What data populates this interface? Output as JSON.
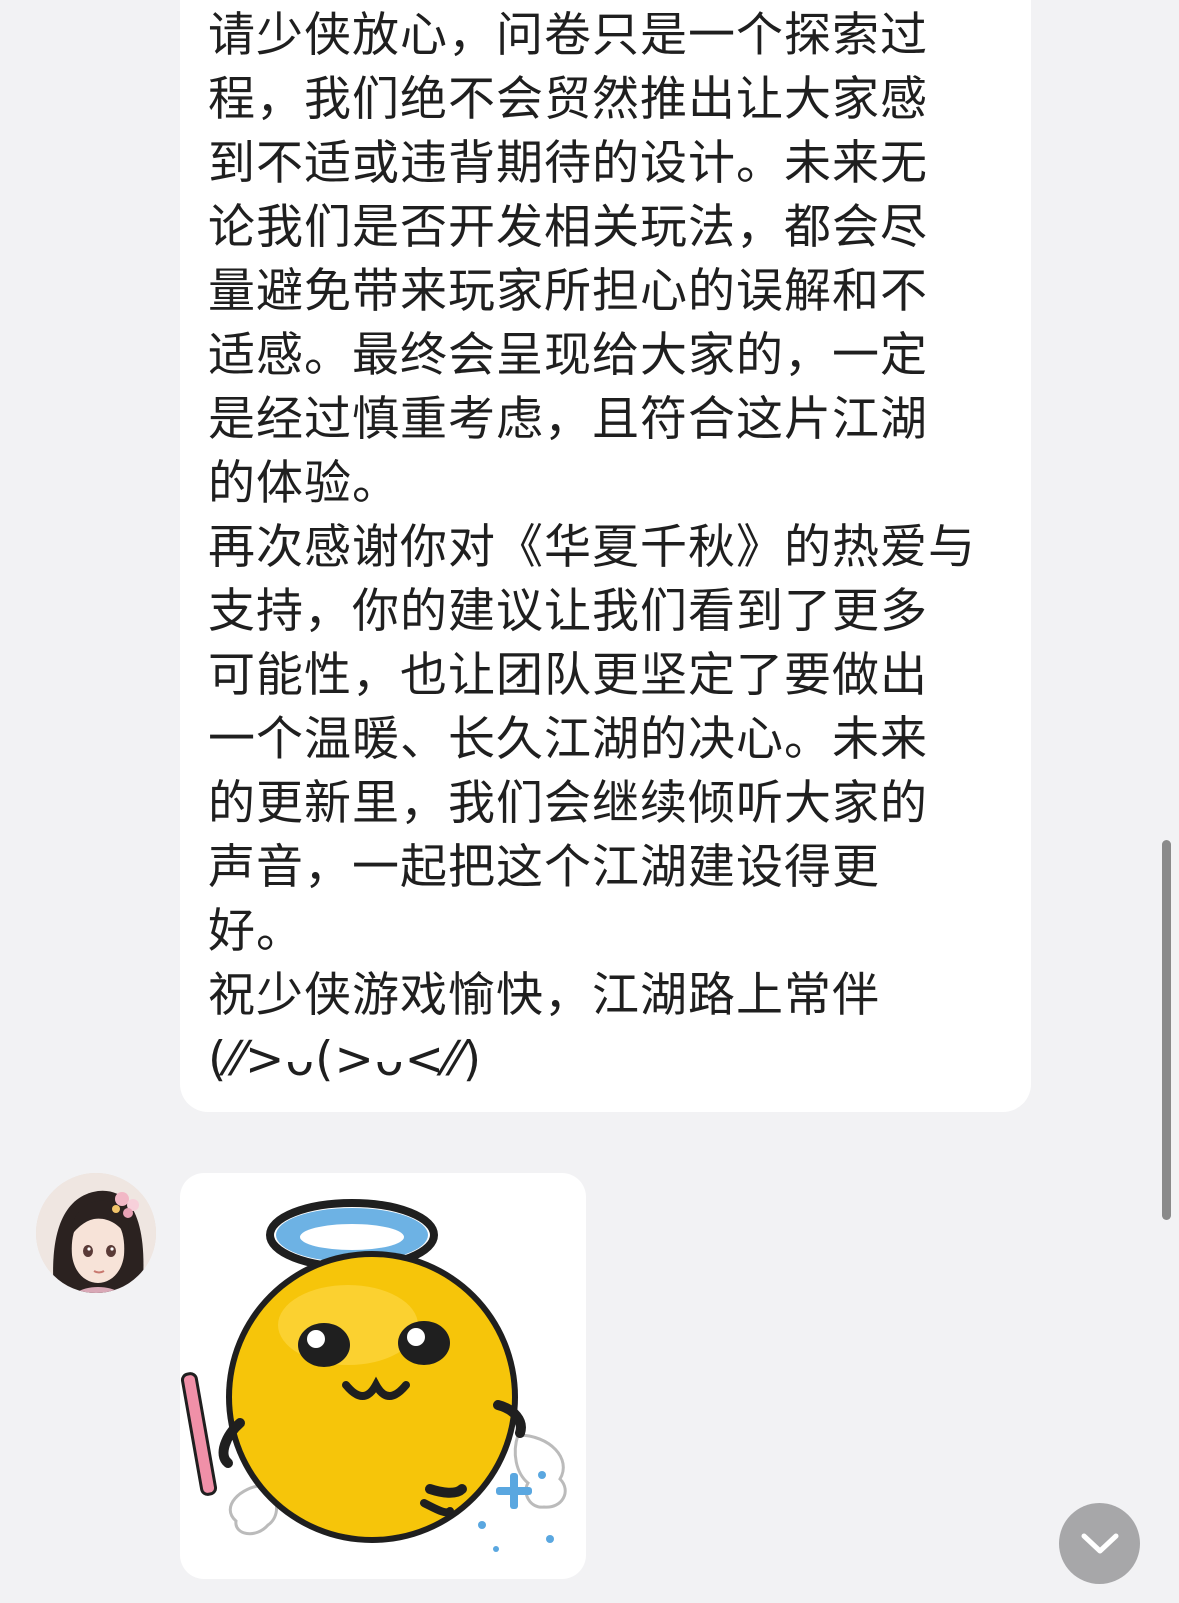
{
  "message": {
    "paragraphs": [
      {
        "lines": [
          "请少侠放心，问卷只是一个探索过",
          "程，我们绝不会贸然推出让大家感",
          "到不适或违背期待的设计。未来无",
          "论我们是否开发相关玩法，都会尽",
          "量避免带来玩家所担心的误解和不",
          "适感。最终会呈现给大家的，一定",
          "是经过慎重考虑，且符合这片江湖",
          "的体验。"
        ]
      },
      {
        "lines": [
          "再次感谢你对《华夏千秋》的热爱与",
          "支持，你的建议让我们看到了更多",
          "可能性，也让团队更坚定了要做出",
          "一个温暖、长久江湖的决心。未来",
          "的更新里，我们会继续倾听大家的",
          "声音，一起把这个江湖建设得更",
          "好。"
        ]
      },
      {
        "lines": [
          "祝少侠游戏愉快，江湖路上常伴",
          "(⁄⁄>ᴗ(>ᴗ<⁄⁄)"
        ]
      }
    ]
  },
  "avatar": {
    "icon": "avatar-anime-girl"
  },
  "sticker": {
    "icon": "angel-emoji-sticker"
  },
  "controls": {
    "scroll_down_icon": "chevron-down-icon"
  },
  "colors": {
    "background": "#f2f2f4",
    "bubble": "#ffffff",
    "text": "#1f1f1f",
    "emoji_yellow": "#f6c50a",
    "halo_blue": "#6db2e4",
    "wand_pink": "#f090a8",
    "scroll_button": "#a7a7a9"
  }
}
